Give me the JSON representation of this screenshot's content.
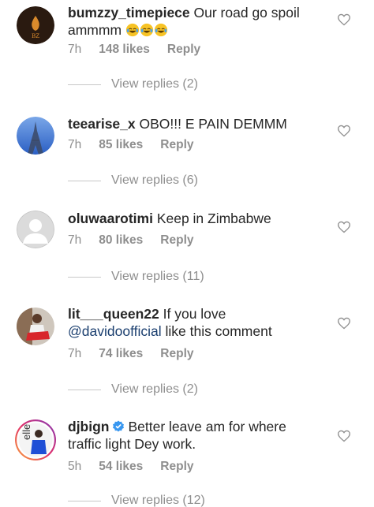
{
  "comments": [
    {
      "username": "bumzzy_timepiece",
      "text": "Our road go spoil ammmm",
      "emoji_count": 3,
      "emoji_name": "face-with-tears-of-joy",
      "time": "7h",
      "likes": "148 likes",
      "reply": "Reply",
      "view_replies": "View replies (2)",
      "avatar_logo": "BZ"
    },
    {
      "username": "teearise_x",
      "text": "OBO!!! E PAIN DEMMM",
      "time": "7h",
      "likes": "85 likes",
      "reply": "Reply",
      "view_replies": "View replies (6)"
    },
    {
      "username": "oluwaarotimi",
      "text": "Keep in Zimbabwe",
      "time": "7h",
      "likes": "80 likes",
      "reply": "Reply",
      "view_replies": "View replies (11)"
    },
    {
      "username": "lit___queen22",
      "text_before": "If you love",
      "mention": "@davidoofficial",
      "text_after": "like this comment",
      "time": "7h",
      "likes": "74 likes",
      "reply": "Reply",
      "view_replies": "View replies (2)"
    },
    {
      "username": "djbign",
      "verified": true,
      "text": "Better leave am for where traffic light Dey work.",
      "time": "5h",
      "likes": "54 likes",
      "reply": "Reply",
      "view_replies": "View replies (12)",
      "avatar_text": "elle"
    }
  ],
  "colors": {
    "text": "#262626",
    "meta": "#8e8e8e",
    "mention": "#1b3f6f",
    "verified": "#3897f0"
  }
}
